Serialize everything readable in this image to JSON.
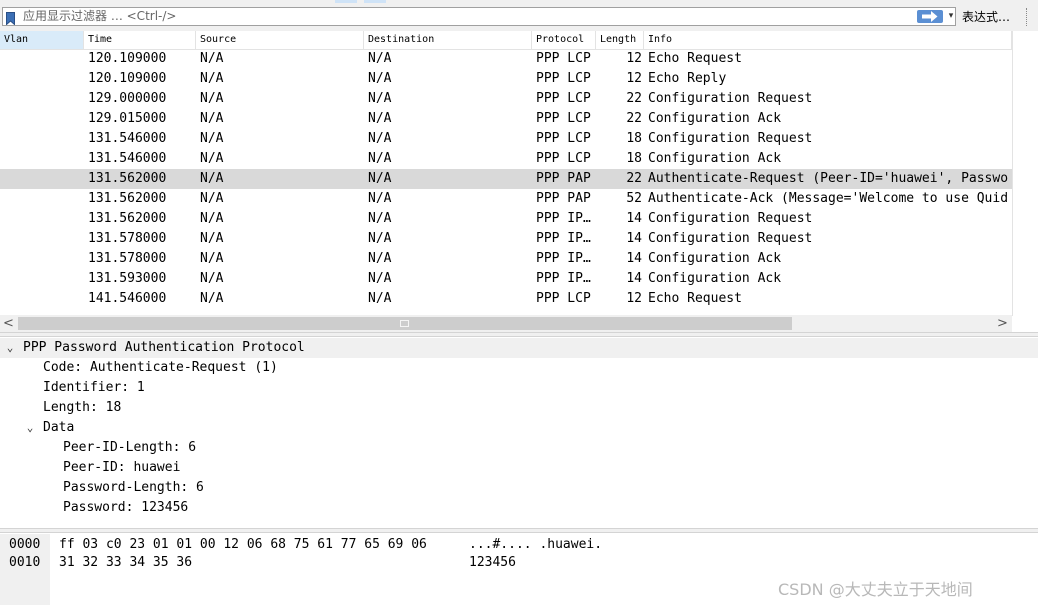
{
  "filter_bar": {
    "placeholder": "应用显示过滤器 … <Ctrl-/>",
    "history_glyph": "▾",
    "expression_label": "表达式…",
    "icons": {
      "bookmark": "bookmark-icon",
      "apply": "right-arrow-icon"
    }
  },
  "packet_list": {
    "columns": [
      "Vlan",
      "Time",
      "Source",
      "Destination",
      "Protocol",
      "Length",
      "Info"
    ],
    "rows": [
      {
        "vlan": "",
        "time": "120.109000",
        "source": "N/A",
        "destination": "N/A",
        "protocol": "PPP LCP",
        "length": "12",
        "info": "Echo Request"
      },
      {
        "vlan": "",
        "time": "120.109000",
        "source": "N/A",
        "destination": "N/A",
        "protocol": "PPP LCP",
        "length": "12",
        "info": "Echo Reply"
      },
      {
        "vlan": "",
        "time": "129.000000",
        "source": "N/A",
        "destination": "N/A",
        "protocol": "PPP LCP",
        "length": "22",
        "info": "Configuration Request"
      },
      {
        "vlan": "",
        "time": "129.015000",
        "source": "N/A",
        "destination": "N/A",
        "protocol": "PPP LCP",
        "length": "22",
        "info": "Configuration Ack"
      },
      {
        "vlan": "",
        "time": "131.546000",
        "source": "N/A",
        "destination": "N/A",
        "protocol": "PPP LCP",
        "length": "18",
        "info": "Configuration Request"
      },
      {
        "vlan": "",
        "time": "131.546000",
        "source": "N/A",
        "destination": "N/A",
        "protocol": "PPP LCP",
        "length": "18",
        "info": "Configuration Ack"
      },
      {
        "vlan": "",
        "time": "131.562000",
        "source": "N/A",
        "destination": "N/A",
        "protocol": "PPP PAP",
        "length": "22",
        "info": "Authenticate-Request (Peer-ID='huawei', Passwo"
      },
      {
        "vlan": "",
        "time": "131.562000",
        "source": "N/A",
        "destination": "N/A",
        "protocol": "PPP PAP",
        "length": "52",
        "info": "Authenticate-Ack (Message='Welcome to use Quid"
      },
      {
        "vlan": "",
        "time": "131.562000",
        "source": "N/A",
        "destination": "N/A",
        "protocol": "PPP IP…",
        "length": "14",
        "info": "Configuration Request"
      },
      {
        "vlan": "",
        "time": "131.578000",
        "source": "N/A",
        "destination": "N/A",
        "protocol": "PPP IP…",
        "length": "14",
        "info": "Configuration Request"
      },
      {
        "vlan": "",
        "time": "131.578000",
        "source": "N/A",
        "destination": "N/A",
        "protocol": "PPP IP…",
        "length": "14",
        "info": "Configuration Ack"
      },
      {
        "vlan": "",
        "time": "131.593000",
        "source": "N/A",
        "destination": "N/A",
        "protocol": "PPP IP…",
        "length": "14",
        "info": "Configuration Ack"
      },
      {
        "vlan": "",
        "time": "141.546000",
        "source": "N/A",
        "destination": "N/A",
        "protocol": "PPP LCP",
        "length": "12",
        "info": "Echo Request"
      }
    ],
    "selected_row": 6,
    "scroll": {
      "left_glyph": "<",
      "right_glyph": ">"
    }
  },
  "details": {
    "lines": [
      {
        "text": "PPP Password Authentication Protocol",
        "level": 0,
        "expander": "⌄",
        "selected": true
      },
      {
        "text": "Code: Authenticate-Request (1)",
        "level": 1,
        "expander": ""
      },
      {
        "text": "Identifier: 1",
        "level": 1,
        "expander": ""
      },
      {
        "text": "Length: 18",
        "level": 1,
        "expander": ""
      },
      {
        "text": "Data",
        "level": 1,
        "expander": "⌄"
      },
      {
        "text": "Peer-ID-Length: 6",
        "level": 2,
        "expander": ""
      },
      {
        "text": "Peer-ID: huawei",
        "level": 2,
        "expander": ""
      },
      {
        "text": "Password-Length: 6",
        "level": 2,
        "expander": ""
      },
      {
        "text": "Password: 123456",
        "level": 2,
        "expander": ""
      }
    ]
  },
  "bytes": {
    "rows": [
      {
        "offset": "0000",
        "hex": "ff 03 c0 23 01 01 00 12  06 68 75 61 77 65 69 06",
        "ascii": "...#.... .huawei."
      },
      {
        "offset": "0010",
        "hex": "31 32 33 34 35 36",
        "ascii": "123456"
      }
    ]
  },
  "watermark": "CSDN @大丈夫立于天地间"
}
